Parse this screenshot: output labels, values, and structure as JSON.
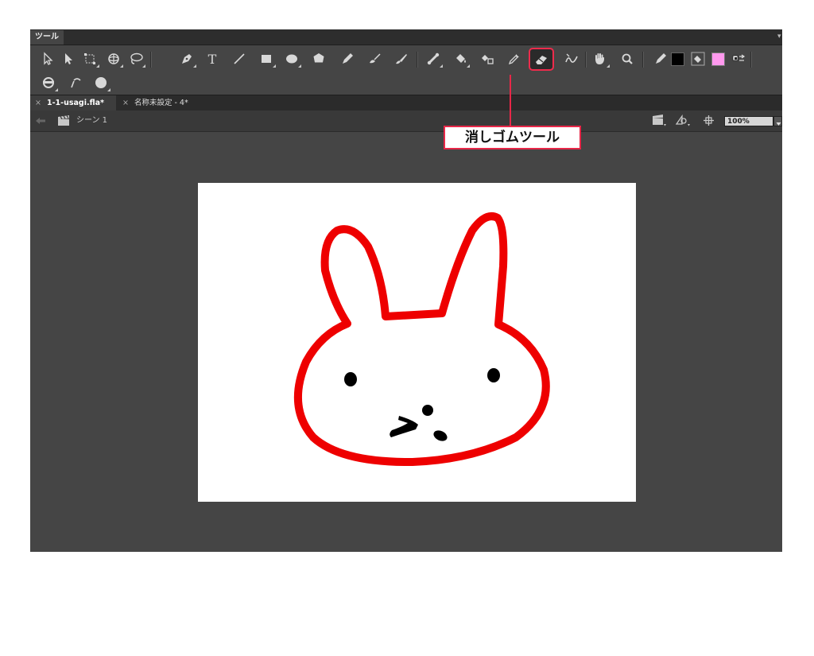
{
  "panel": {
    "tab_label": "ツール"
  },
  "documents": {
    "tabs": [
      {
        "label": "1-1-usagi.fla*",
        "close": "×",
        "active": true
      },
      {
        "label": "名称未設定 - 4*",
        "close": "×",
        "active": false
      }
    ]
  },
  "scene": {
    "label": "シーン 1",
    "zoom": "100%"
  },
  "colors": {
    "stroke": "#000000",
    "fill": "#ff99ee",
    "highlight": "#e82748",
    "bunny_outline": "#ee0000"
  },
  "callout": {
    "label": "消しゴムツール",
    "target": "eraser-tool"
  },
  "tools": [
    "selection",
    "subselection",
    "free-transform",
    "3d-rotation",
    "lasso",
    "pen",
    "text",
    "line",
    "rectangle",
    "oval",
    "polystar",
    "pencil",
    "brush",
    "paint-brush",
    "bone",
    "paint-bucket",
    "ink-bottle",
    "eyedropper",
    "eraser",
    "width",
    "hand",
    "zoom"
  ]
}
